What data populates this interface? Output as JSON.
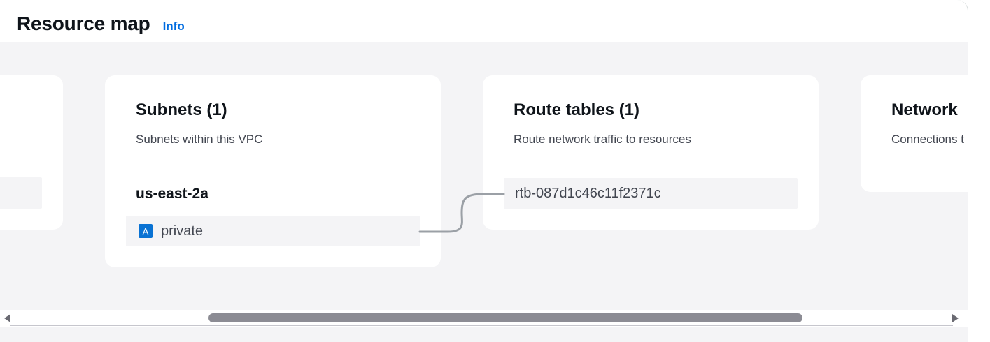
{
  "header": {
    "title": "Resource map",
    "info_label": "Info"
  },
  "subnets": {
    "title": "Subnets (1)",
    "description": "Subnets within this VPC",
    "availability_zone": "us-east-2a",
    "items": [
      {
        "badge": "A",
        "label": "private"
      }
    ]
  },
  "route_tables": {
    "title": "Route tables (1)",
    "description": "Route network traffic to resources",
    "items": [
      {
        "label": "rtb-087d1c46c11f2371c"
      }
    ]
  },
  "network_connections": {
    "title": "Network",
    "description": "Connections t"
  },
  "colors": {
    "accent": "#006ce0",
    "badge": "#0972d3",
    "map_background": "#f4f4f6",
    "connector": "#9ba0a6"
  }
}
